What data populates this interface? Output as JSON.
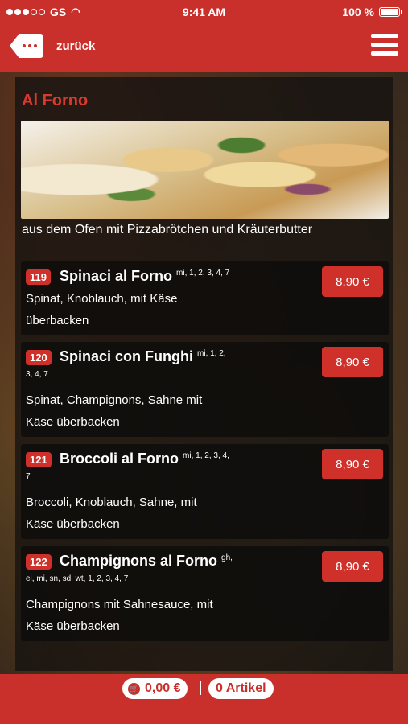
{
  "status_bar": {
    "carrier": "GS",
    "time": "9:41 AM",
    "battery": "100 %"
  },
  "nav": {
    "back_label": "zurück",
    "back_icon": "ellipsis-back-icon",
    "menu_icon": "hamburger-menu-icon"
  },
  "category": {
    "title": "Al Forno",
    "description": "aus dem Ofen mit Pizzabrötchen und Kräuterbutter"
  },
  "items": [
    {
      "number": "119",
      "name": "Spinaci al Forno",
      "allergens": "mi, 1, 2, 3, 4, 7",
      "allergens_cont": "",
      "desc_line1": "Spinat, Knoblauch, mit Käse",
      "desc_line2": "überbacken",
      "price": "8,90 €"
    },
    {
      "number": "120",
      "name": "Spinaci con Funghi",
      "allergens": "mi, 1, 2,",
      "allergens_cont": "3, 4, 7",
      "desc_line1": "Spinat, Champignons, Sahne mit",
      "desc_line2": "Käse überbacken",
      "price": "8,90 €"
    },
    {
      "number": "121",
      "name": "Broccoli al Forno",
      "allergens": "mi, 1, 2, 3, 4,",
      "allergens_cont": "7",
      "desc_line1": "Broccoli, Knoblauch, Sahne, mit",
      "desc_line2": "Käse überbacken",
      "price": "8,90 €"
    },
    {
      "number": "122",
      "name": "Champignons al Forno",
      "allergens": "gh,",
      "allergens_cont": "ei, mi, sn, sd, wt, 1, 2, 3, 4, 7",
      "desc_line1": "Champignons mit Sahnesauce, mit",
      "desc_line2": "Käse überbacken",
      "price": "8,90 €"
    }
  ],
  "footer": {
    "cart_total": "0,00 €",
    "article_count": "0 Artikel"
  },
  "colors": {
    "accent": "#c9302c",
    "price_button": "#d0302a",
    "title": "#d9392f"
  }
}
